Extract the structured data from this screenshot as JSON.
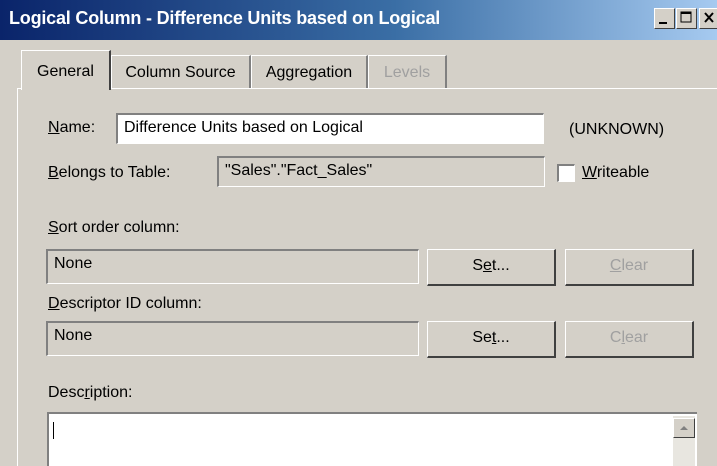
{
  "window": {
    "title": "Logical Column - Difference Units based on Logical",
    "minimize_label": "_",
    "maximize_label": "□",
    "close_label": "×"
  },
  "tabs": [
    {
      "label": "General",
      "state": "active"
    },
    {
      "label": "Column Source",
      "state": "normal"
    },
    {
      "label": "Aggregation",
      "state": "normal"
    },
    {
      "label": "Levels",
      "state": "disabled"
    }
  ],
  "general": {
    "name_label": {
      "hotkey": "N",
      "rest": "ame:"
    },
    "name_value": "Difference Units based on Logical",
    "type_text": "(UNKNOWN)",
    "belongs_label": {
      "hotkey": "B",
      "rest": "elongs to Table:"
    },
    "belongs_value": "\"Sales\".\"Fact_Sales\"",
    "writeable_label": {
      "hotkey": "W",
      "rest": "riteable"
    },
    "writeable_checked": false,
    "sort_label": {
      "hotkey": "S",
      "rest": "ort order column:"
    },
    "sort_value": "None",
    "sort_set_button": {
      "pre": "S",
      "hotkey": "e",
      "post": "t..."
    },
    "sort_clear_button": {
      "hotkey": "C",
      "rest": "lear"
    },
    "descriptor_label": {
      "hotkey": "D",
      "rest": "escriptor ID column:"
    },
    "descriptor_value": "None",
    "descriptor_set_button": {
      "pre": "Se",
      "hotkey": "t",
      "post": "..."
    },
    "descriptor_clear_button": {
      "pre": "C",
      "hotkey": "l",
      "post": "ear"
    },
    "description_label": {
      "pre": "Desc",
      "hotkey": "r",
      "post": "iption:"
    },
    "description_value": ""
  },
  "colors": {
    "titlebar_start": "#0a246a",
    "titlebar_end": "#a6caf0",
    "face": "#d4d0c8",
    "disabled_text": "#a0a0a0"
  }
}
